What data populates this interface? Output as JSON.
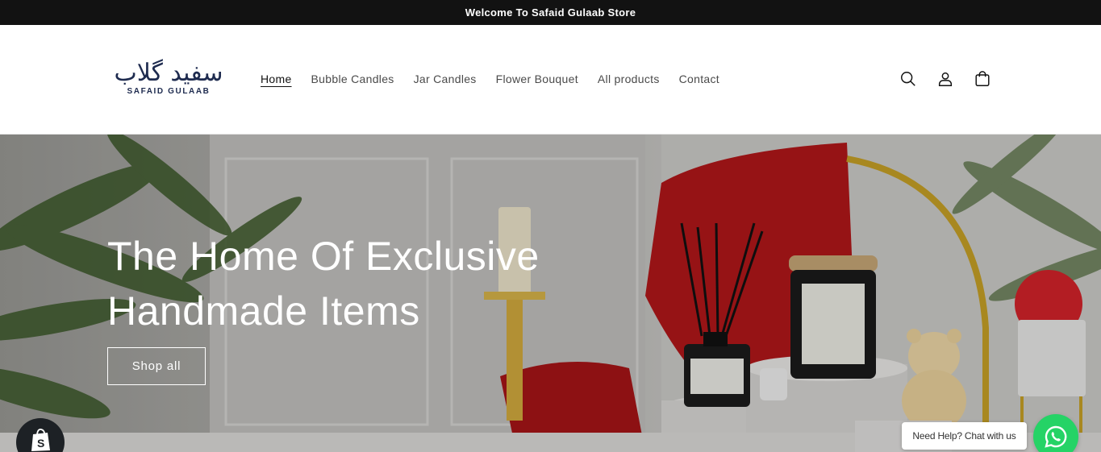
{
  "announcement": "Welcome To Safaid Gulaab Store",
  "logo": {
    "script": "سفید گلاب",
    "text": "SAFAID GULAAB"
  },
  "nav": [
    {
      "label": "Home",
      "active": true
    },
    {
      "label": "Bubble Candles"
    },
    {
      "label": "Jar Candles"
    },
    {
      "label": "Flower Bouquet"
    },
    {
      "label": "All products"
    },
    {
      "label": "Contact"
    }
  ],
  "header_icons": [
    "search-icon",
    "account-icon",
    "cart-icon"
  ],
  "hero": {
    "title_line1": "The Home Of Exclusive",
    "title_line2": "Handmade Items",
    "cta": "Shop all"
  },
  "chat": {
    "label": "Need Help? Chat with us",
    "icon": "whatsapp-icon"
  },
  "shopify_badge_icon": "shopify-bag-icon",
  "colors": {
    "announce_bg": "#121212",
    "whatsapp": "#25d366",
    "logo": "#1e2b4f"
  }
}
